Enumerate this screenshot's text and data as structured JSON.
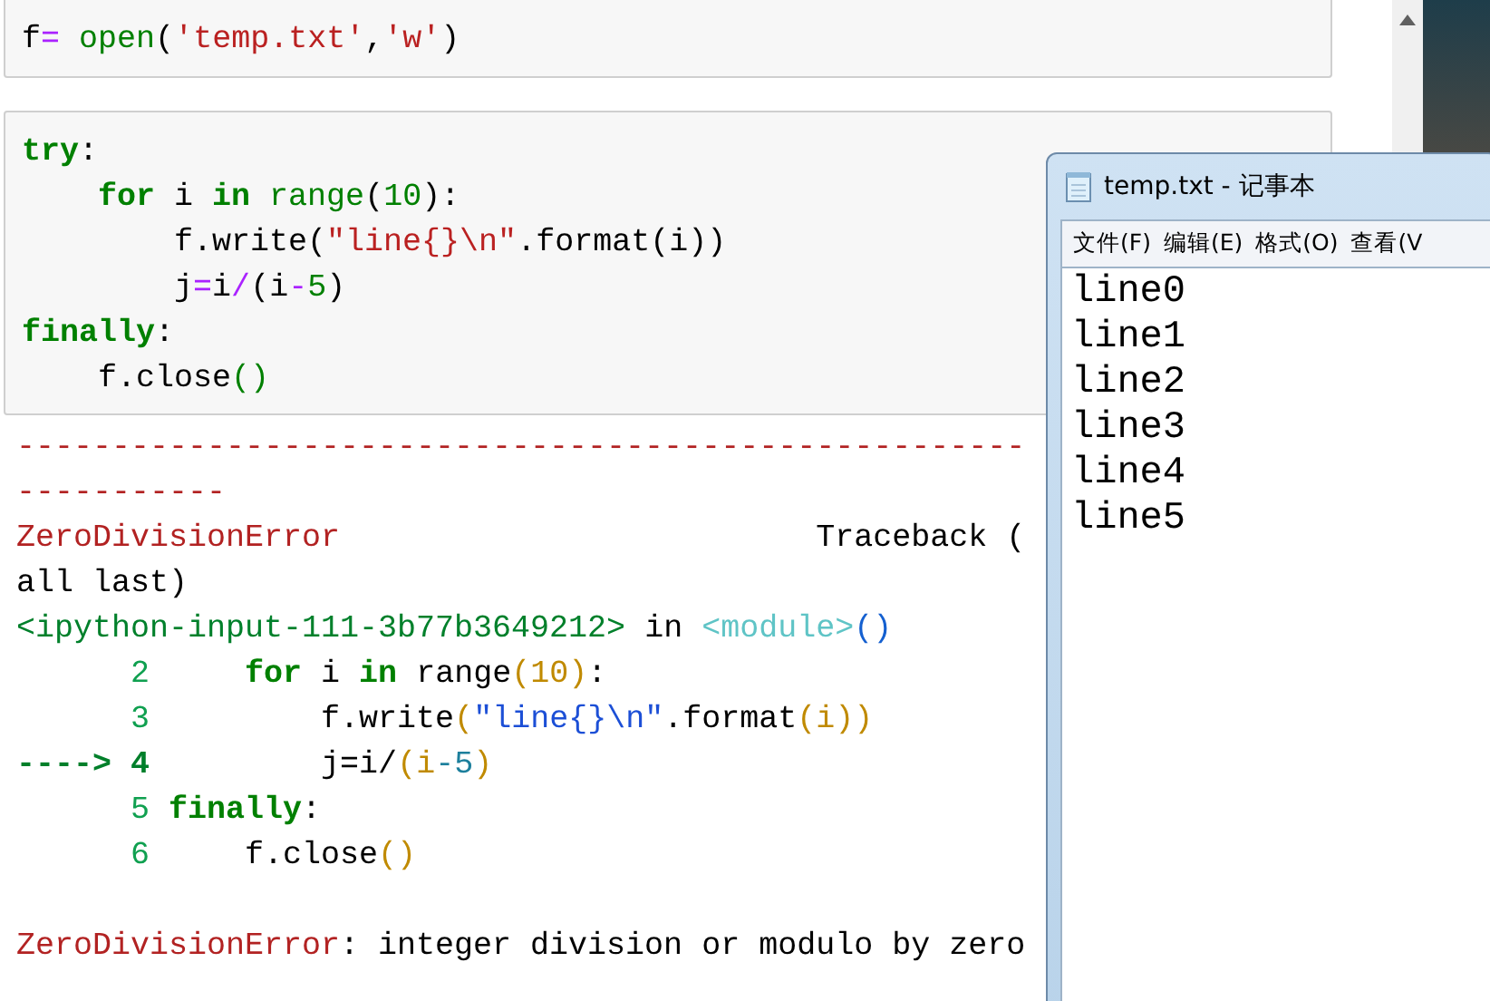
{
  "cells": [
    {
      "lines": [
        [
          {
            "text": "f",
            "kind": "plain"
          },
          {
            "text": "=",
            "kind": "op"
          },
          {
            "text": " open",
            "kind": "builtin"
          },
          {
            "text": "(",
            "kind": "plain"
          },
          {
            "text": "'temp.txt'",
            "kind": "str"
          },
          {
            "text": ",",
            "kind": "plain"
          },
          {
            "text": "'w'",
            "kind": "str"
          },
          {
            "text": ")",
            "kind": "plain"
          }
        ]
      ]
    },
    {
      "lines": [
        [
          {
            "text": "try",
            "kind": "kw"
          },
          {
            "text": ":",
            "kind": "plain"
          }
        ],
        [
          {
            "text": "    for",
            "kind": "kw"
          },
          {
            "text": " i ",
            "kind": "plain"
          },
          {
            "text": "in",
            "kind": "kw"
          },
          {
            "text": " range",
            "kind": "builtin"
          },
          {
            "text": "(",
            "kind": "plain"
          },
          {
            "text": "10",
            "kind": "num"
          },
          {
            "text": "):",
            "kind": "plain"
          }
        ],
        [
          {
            "text": "        f.write(",
            "kind": "plain"
          },
          {
            "text": "\"line{}\\n\"",
            "kind": "str"
          },
          {
            "text": ".format(i))",
            "kind": "plain"
          }
        ],
        [
          {
            "text": "        j",
            "kind": "plain"
          },
          {
            "text": "=",
            "kind": "op"
          },
          {
            "text": "i",
            "kind": "plain"
          },
          {
            "text": "/",
            "kind": "op"
          },
          {
            "text": "(i",
            "kind": "plain"
          },
          {
            "text": "-",
            "kind": "op"
          },
          {
            "text": "5",
            "kind": "num"
          },
          {
            "text": ")",
            "kind": "plain"
          }
        ],
        [
          {
            "text": "finally",
            "kind": "kw"
          },
          {
            "text": ":",
            "kind": "plain"
          }
        ],
        [
          {
            "text": "    f.close",
            "kind": "plain"
          },
          {
            "text": "()",
            "kind": "builtin"
          }
        ]
      ]
    }
  ],
  "output": {
    "lines": [
      {
        "kind": "trace",
        "tokens": [
          {
            "text": "-----------------------------------------------------",
            "kind": "err"
          }
        ]
      },
      {
        "kind": "trace",
        "tokens": [
          {
            "text": "-----------",
            "kind": "err"
          }
        ]
      },
      {
        "kind": "trace",
        "tokens": [
          {
            "text": "ZeroDivisionError",
            "kind": "err"
          },
          {
            "text": "                         Traceback (",
            "kind": "plain"
          }
        ]
      },
      {
        "kind": "trace",
        "tokens": [
          {
            "text": "all last)",
            "kind": "plain"
          }
        ]
      },
      {
        "kind": "trace",
        "tokens": [
          {
            "text": "<ipython-input-111-3b77b3649212>",
            "kind": "file"
          },
          {
            "text": " in ",
            "kind": "plain"
          },
          {
            "text": "<module>",
            "kind": "module"
          },
          {
            "text": "()",
            "kind": "paren"
          }
        ]
      },
      {
        "kind": "trace",
        "tokens": [
          {
            "text": "      2",
            "kind": "lineno"
          },
          {
            "text": "     for",
            "kind": "kw"
          },
          {
            "text": " i ",
            "kind": "plain"
          },
          {
            "text": "in",
            "kind": "kw"
          },
          {
            "text": " range",
            "kind": "plain"
          },
          {
            "text": "(10)",
            "kind": "brace"
          },
          {
            "text": ":",
            "kind": "plain"
          }
        ]
      },
      {
        "kind": "trace",
        "tokens": [
          {
            "text": "      3",
            "kind": "lineno"
          },
          {
            "text": "         f.write",
            "kind": "plain"
          },
          {
            "text": "(",
            "kind": "brace"
          },
          {
            "text": "\"line{}\\n\"",
            "kind": "tstr"
          },
          {
            "text": ".format",
            "kind": "plain"
          },
          {
            "text": "(i))",
            "kind": "brace"
          }
        ]
      },
      {
        "kind": "trace",
        "tokens": [
          {
            "text": "----> 4",
            "kind": "arrow"
          },
          {
            "text": "         j",
            "kind": "plain"
          },
          {
            "text": "=i/",
            "kind": "plain"
          },
          {
            "text": "(i",
            "kind": "brace"
          },
          {
            "text": "-5",
            "kind": "num2"
          },
          {
            "text": ")",
            "kind": "brace"
          }
        ]
      },
      {
        "kind": "trace",
        "tokens": [
          {
            "text": "      5",
            "kind": "lineno"
          },
          {
            "text": " finally",
            "kind": "kw"
          },
          {
            "text": ":",
            "kind": "plain"
          }
        ]
      },
      {
        "kind": "trace",
        "tokens": [
          {
            "text": "      6",
            "kind": "lineno"
          },
          {
            "text": "     f.close",
            "kind": "plain"
          },
          {
            "text": "()",
            "kind": "brace"
          }
        ]
      },
      {
        "kind": "message",
        "tokens": [
          {
            "text": "ZeroDivisionError",
            "kind": "err"
          },
          {
            "text": ": integer division or modulo by zero",
            "kind": "plain"
          }
        ]
      }
    ]
  },
  "notepad": {
    "title": "temp.txt - 记事本",
    "menu": [
      "文件(F)",
      "编辑(E)",
      "格式(O)",
      "查看(V"
    ],
    "lines": [
      "line0",
      "line1",
      "line2",
      "line3",
      "line4",
      "line5"
    ]
  }
}
